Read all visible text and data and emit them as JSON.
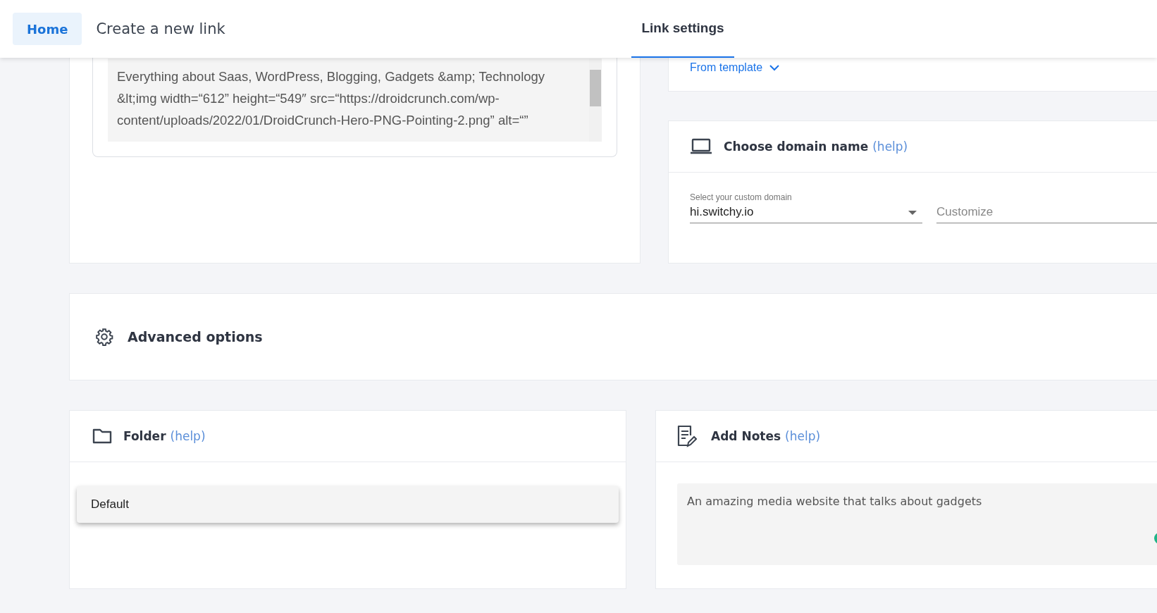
{
  "header": {
    "tabs": [
      {
        "label": "Home",
        "selected": true
      },
      {
        "label": "Create a new link",
        "selected": false
      }
    ],
    "panel_tabs": [
      {
        "label": "Link settings",
        "selected": true
      }
    ]
  },
  "description": {
    "value": "Everything about Saas, WordPress, Blogging, Gadgets &amp; Technology &lt;img width=“612” height=“549″ src=“https://droidcrunch.com/wp-content/uploads/2022/01/DroidCrunch-Hero-PNG-Pointing-2.png” alt=“”"
  },
  "template": {
    "label": "From template"
  },
  "domain": {
    "title": "Choose domain name",
    "help": "(help)",
    "select": {
      "label": "Select your custom domain",
      "value": "hi.switchy.io"
    },
    "custom": {
      "placeholder": "Customize"
    }
  },
  "advanced": {
    "title": "Advanced options"
  },
  "folder": {
    "title": "Folder",
    "help": "(help)",
    "menu": [
      {
        "label": "Default"
      }
    ]
  },
  "notes": {
    "title": "Add Notes",
    "help": "(help)",
    "value": "An amazing media website that talks about gadgets"
  }
}
